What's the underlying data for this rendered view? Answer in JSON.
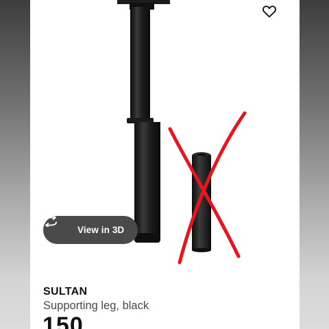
{
  "product": {
    "name": "SULTAN",
    "description": "Supporting leg, black",
    "price": "150"
  },
  "actions": {
    "view_3d_label": "View in 3D",
    "favourite_icon": "heart-icon",
    "view_3d_icon": "rotate-3d-icon"
  },
  "colors": {
    "cross_out": "#e8141e",
    "product": "#1a1a1a",
    "badge_bg": "#4a4a4a"
  }
}
